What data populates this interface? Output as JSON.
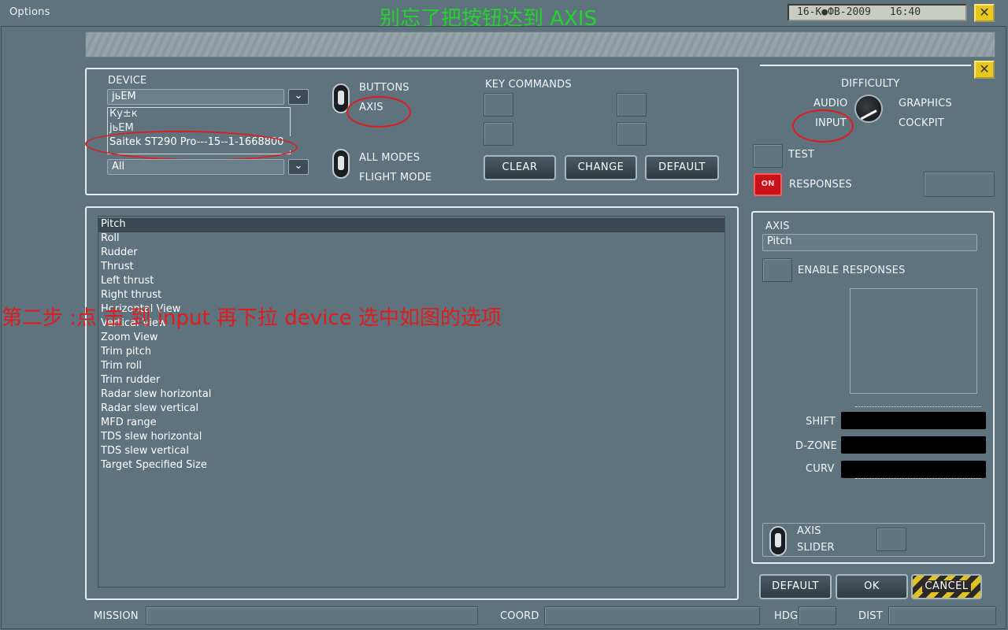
{
  "window": {
    "title": "Options",
    "banner": "别忘了把按钮达到 AXIS",
    "close": "✕"
  },
  "clock": {
    "date": "16-К●ФВ-2009",
    "time": "16:40"
  },
  "device_panel": {
    "device_label": "DEVICE",
    "device_value": "јьЕМ",
    "dropdown_options": [
      "Ку±к",
      "јьЕМ",
      "Saitek ST290 Pro---15--1-1668800"
    ],
    "flight_mode_label": "FLIGHT MODE",
    "mode_value": "All",
    "dd_arrow": "⌄"
  },
  "toggles": {
    "buttons": "BUTTONS",
    "axis": "AXIS",
    "all_modes": "ALL MODES",
    "flight_mode": "FLIGHT MODE"
  },
  "key_commands": {
    "label": "KEY COMMANDS",
    "clear": "CLEAR",
    "change": "CHANGE",
    "default": "DEFAULT"
  },
  "axes_list": [
    "Pitch",
    "Roll",
    "Rudder",
    "Thrust",
    "Left thrust",
    "Right thrust",
    "Horizontal View",
    "Vertical View",
    "Zoom View",
    "Trim pitch",
    "Trim roll",
    "Trim rudder",
    "Radar slew horizontal",
    "Radar slew vertical",
    "MFD range",
    "TDS slew horizontal",
    "TDS slew vertical",
    "Target Specified Size"
  ],
  "annotation": "第二步 :点 击 到 input  再下拉 device 选中如图的选项",
  "settings": {
    "difficulty": "DIFFICULTY",
    "audio": "AUDIO",
    "graphics": "GRAPHICS",
    "input": "INPUT",
    "cockpit": "COCKPIT",
    "test": "TEST",
    "on": "ON",
    "responses": "RESPONSES"
  },
  "axis_panel": {
    "axis_label": "AXIS",
    "axis_value": "Pitch",
    "enable_responses": "ENABLE RESPONSES",
    "shift": "SHIFT",
    "dzone": "D-ZONE",
    "curv": "CURV",
    "axis_toggle": "AXIS",
    "slider_toggle": "SLIDER"
  },
  "bottom_buttons": {
    "default": "DEFAULT",
    "ok": "OK",
    "cancel": "CANCEL"
  },
  "status_bar": {
    "mission": "MISSION",
    "coord": "COORD",
    "hdg": "HDG",
    "dist": "DIST"
  },
  "colors": {
    "background": "#5e737d",
    "banner": "#22d32a",
    "annotation": "#e01d1d",
    "close": "#e8c81e"
  }
}
